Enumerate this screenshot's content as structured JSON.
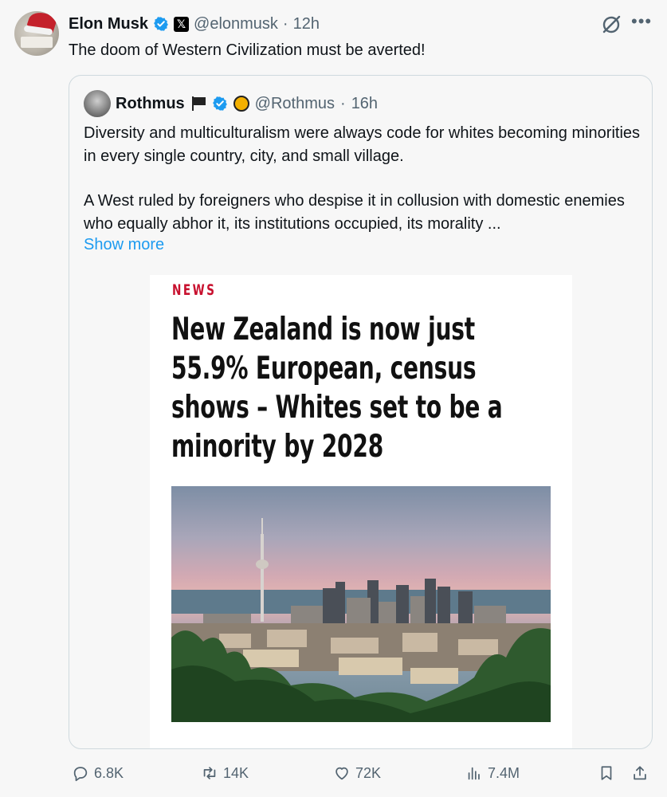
{
  "post": {
    "author_name": "Elon Musk",
    "handle": "@elonmusk",
    "separator": "·",
    "time": "12h",
    "text": "The doom of Western Civilization must be averted!",
    "more_icon": "ellipsis-icon",
    "grok_icon": "grok-icon"
  },
  "quote": {
    "author_name": "Rothmus",
    "handle": "@Rothmus",
    "separator": "·",
    "time": "16h",
    "paragraph1": "Diversity and multiculturalism were always code for whites becoming minorities in every single country, city, and small village.",
    "paragraph2": "A West ruled by foreigners who despise it in collusion with domestic enemies who equally abhor it, its institutions occupied, its morality ...",
    "show_more": "Show more",
    "card": {
      "tag": "NEWS",
      "headline_line1": "New Zealand is now just",
      "headline_line2": "55.9% European, census",
      "headline_line3": "shows – Whites set to be a",
      "headline_line4": "minority by 2028"
    }
  },
  "actions": {
    "replies": "6.8K",
    "reposts": "14K",
    "likes": "72K",
    "views": "7.4M"
  },
  "colors": {
    "accent": "#1d9bf0",
    "muted": "#536471",
    "news_red": "#c8102e",
    "background": "#f7f7f7"
  }
}
